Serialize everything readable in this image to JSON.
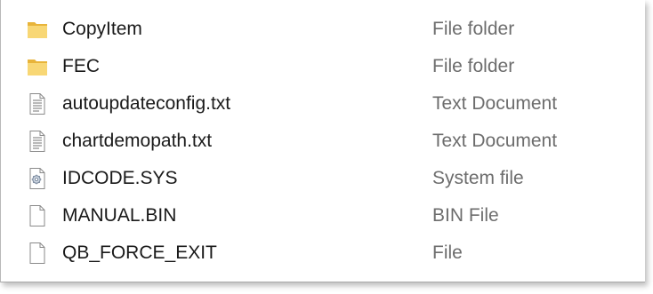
{
  "colors": {
    "folder_yellow": "#f8d775",
    "folder_dark": "#e8b43a",
    "doc_outline": "#8a8a8a",
    "name_text": "#1a1a1a",
    "type_text": "#6d6d6d"
  },
  "files": [
    {
      "name": "CopyItem",
      "type": "File folder",
      "icon": "folder-icon"
    },
    {
      "name": "FEC",
      "type": "File folder",
      "icon": "folder-icon"
    },
    {
      "name": "autoupdateconfig.txt",
      "type": "Text Document",
      "icon": "text-document-icon"
    },
    {
      "name": "chartdemopath.txt",
      "type": "Text Document",
      "icon": "text-document-icon"
    },
    {
      "name": "IDCODE.SYS",
      "type": "System file",
      "icon": "system-file-icon"
    },
    {
      "name": "MANUAL.BIN",
      "type": "BIN File",
      "icon": "blank-file-icon"
    },
    {
      "name": "QB_FORCE_EXIT",
      "type": "File",
      "icon": "blank-file-icon"
    }
  ]
}
